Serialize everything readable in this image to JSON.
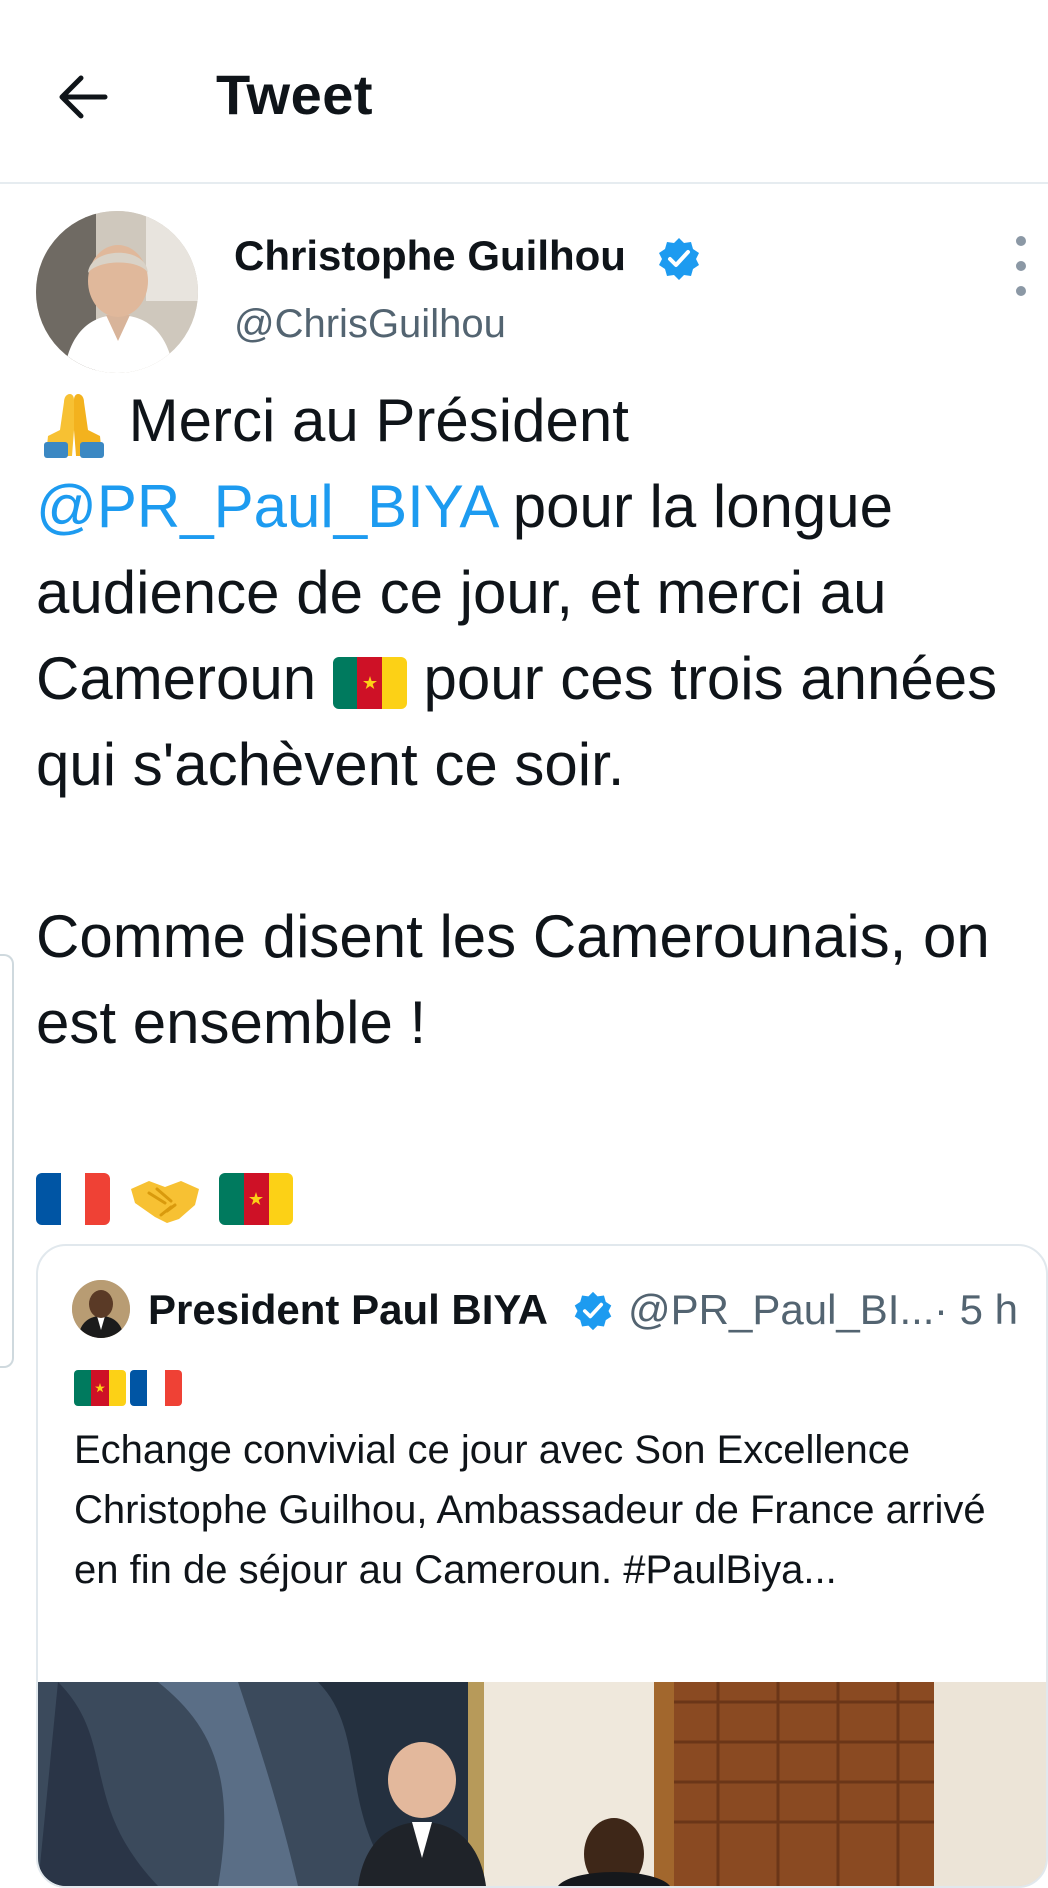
{
  "header": {
    "title": "Tweet",
    "back_icon": "arrow-left-icon"
  },
  "tweet": {
    "author": {
      "name": "Christophe Guilhou",
      "handle": "@ChrisGuilhou",
      "verified_icon": "verified-badge-icon"
    },
    "more_icon": "more-vertical-icon",
    "text": {
      "t1": "Merci au Président ",
      "mention": "@PR_Paul_BIYA",
      "t2": " pour la longue audience de ce jour, et merci au Cameroun ",
      "t3": " pour ces trois années qui s'achèvent ce soir.",
      "p2": "Comme disent les Camerounais, on est ensemble !"
    },
    "emojis": [
      "folded-hands",
      "cameroon-flag",
      "france-flag",
      "handshake",
      "cameroon-flag"
    ]
  },
  "quoted_tweet": {
    "author": {
      "name": "President Paul BIYA",
      "handle": "@PR_Paul_BI...",
      "time": "· 5 h"
    },
    "flags": [
      "cameroon-flag",
      "france-flag"
    ],
    "text": "Echange convivial ce jour avec Son Excellence Christophe Guilhou, Ambassadeur de France arrivé en fin de séjour au Cameroun. #PaulBiya..."
  },
  "colors": {
    "accent": "#1d9bf0",
    "text": "#0f1419",
    "secondary_text": "#536471",
    "border": "#e1e8ed"
  }
}
